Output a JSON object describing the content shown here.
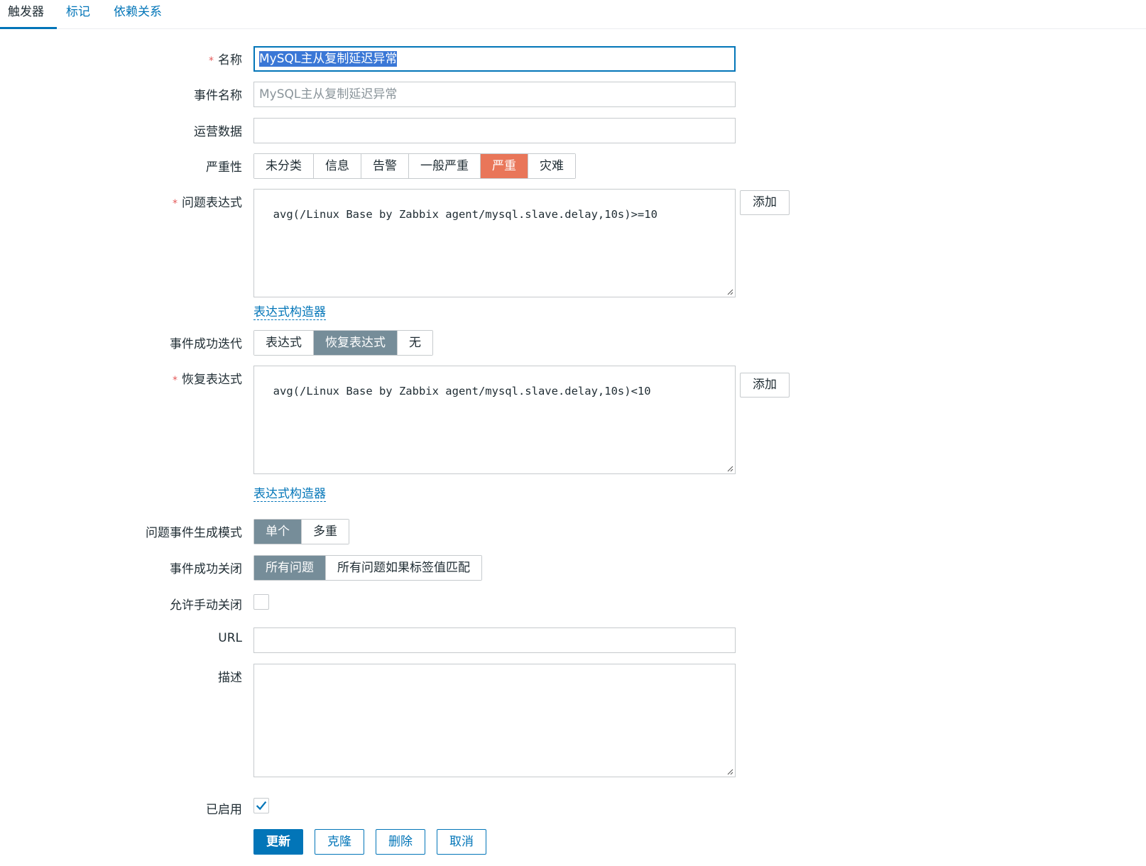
{
  "tabs": [
    {
      "label": "触发器"
    },
    {
      "label": "标记"
    },
    {
      "label": "依赖关系"
    }
  ],
  "form": {
    "required_mark": "*",
    "name": {
      "label": "名称",
      "value": "MySQL主从复制延迟异常"
    },
    "event_name": {
      "label": "事件名称",
      "placeholder": "MySQL主从复制延迟异常"
    },
    "opdata": {
      "label": "运营数据",
      "value": ""
    },
    "severity": {
      "label": "严重性",
      "options": [
        "未分类",
        "信息",
        "告警",
        "一般严重",
        "严重",
        "灾难"
      ],
      "selected": "严重",
      "selected_color": "#e97659"
    },
    "problem_expression": {
      "label": "问题表达式",
      "value": "avg(/Linux Base by Zabbix agent/mysql.slave.delay,10s)>=10",
      "add_label": "添加",
      "constructor_label": "表达式构造器"
    },
    "ok_event_generation": {
      "label": "事件成功迭代",
      "options": [
        "表达式",
        "恢复表达式",
        "无"
      ],
      "selected": "恢复表达式"
    },
    "recovery_expression": {
      "label": "恢复表达式",
      "value": "avg(/Linux Base by Zabbix agent/mysql.slave.delay,10s)<10",
      "add_label": "添加",
      "constructor_label": "表达式构造器"
    },
    "problem_mode": {
      "label": "问题事件生成模式",
      "options": [
        "单个",
        "多重"
      ],
      "selected": "单个"
    },
    "ok_close": {
      "label": "事件成功关闭",
      "options": [
        "所有问题",
        "所有问题如果标签值匹配"
      ],
      "selected": "所有问题"
    },
    "manual_close": {
      "label": "允许手动关闭",
      "checked": false
    },
    "url": {
      "label": "URL",
      "value": ""
    },
    "description": {
      "label": "描述",
      "value": ""
    },
    "enabled": {
      "label": "已启用",
      "checked": true
    }
  },
  "actions": {
    "update": "更新",
    "clone": "克隆",
    "delete": "删除",
    "cancel": "取消"
  },
  "colors": {
    "accent": "#0275b8",
    "selected_segment": "#768d99",
    "severity_high": "#e97659"
  }
}
